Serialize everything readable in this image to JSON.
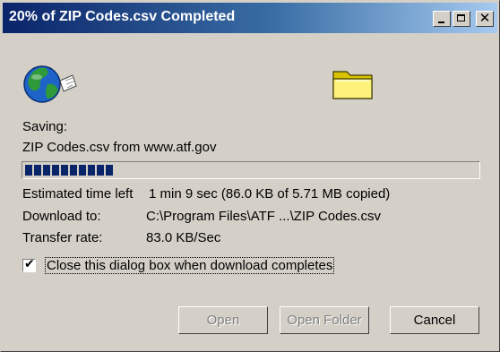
{
  "window": {
    "title": "20% of ZIP Codes.csv Completed",
    "title_controls": {
      "minimize": "minimize-icon",
      "maximize": "maximize-icon",
      "close": "close-icon"
    }
  },
  "icons": {
    "source": "globe-document-icon",
    "destination": "folder-icon"
  },
  "status": {
    "saving_label": "Saving:",
    "file_line": "ZIP Codes.csv from www.atf.gov",
    "progress_percent": 20
  },
  "details": {
    "time_label": "Estimated time left",
    "time_value": "1 min 9 sec (86.0 KB of 5.71 MB copied)",
    "download_label": "Download to:",
    "download_value": "C:\\Program Files\\ATF ...\\ZIP Codes.csv",
    "rate_label": "Transfer rate:",
    "rate_value": "83.0 KB/Sec"
  },
  "options": {
    "close_when_done_label": "Close this dialog box when download completes",
    "close_when_done_checked": true
  },
  "buttons": {
    "open": "Open",
    "open_folder": "Open Folder",
    "cancel": "Cancel"
  },
  "colors": {
    "titlebar_start": "#0a246a",
    "titlebar_end": "#a6caf0",
    "progress": "#0a246a",
    "face": "#d4d0c8"
  }
}
